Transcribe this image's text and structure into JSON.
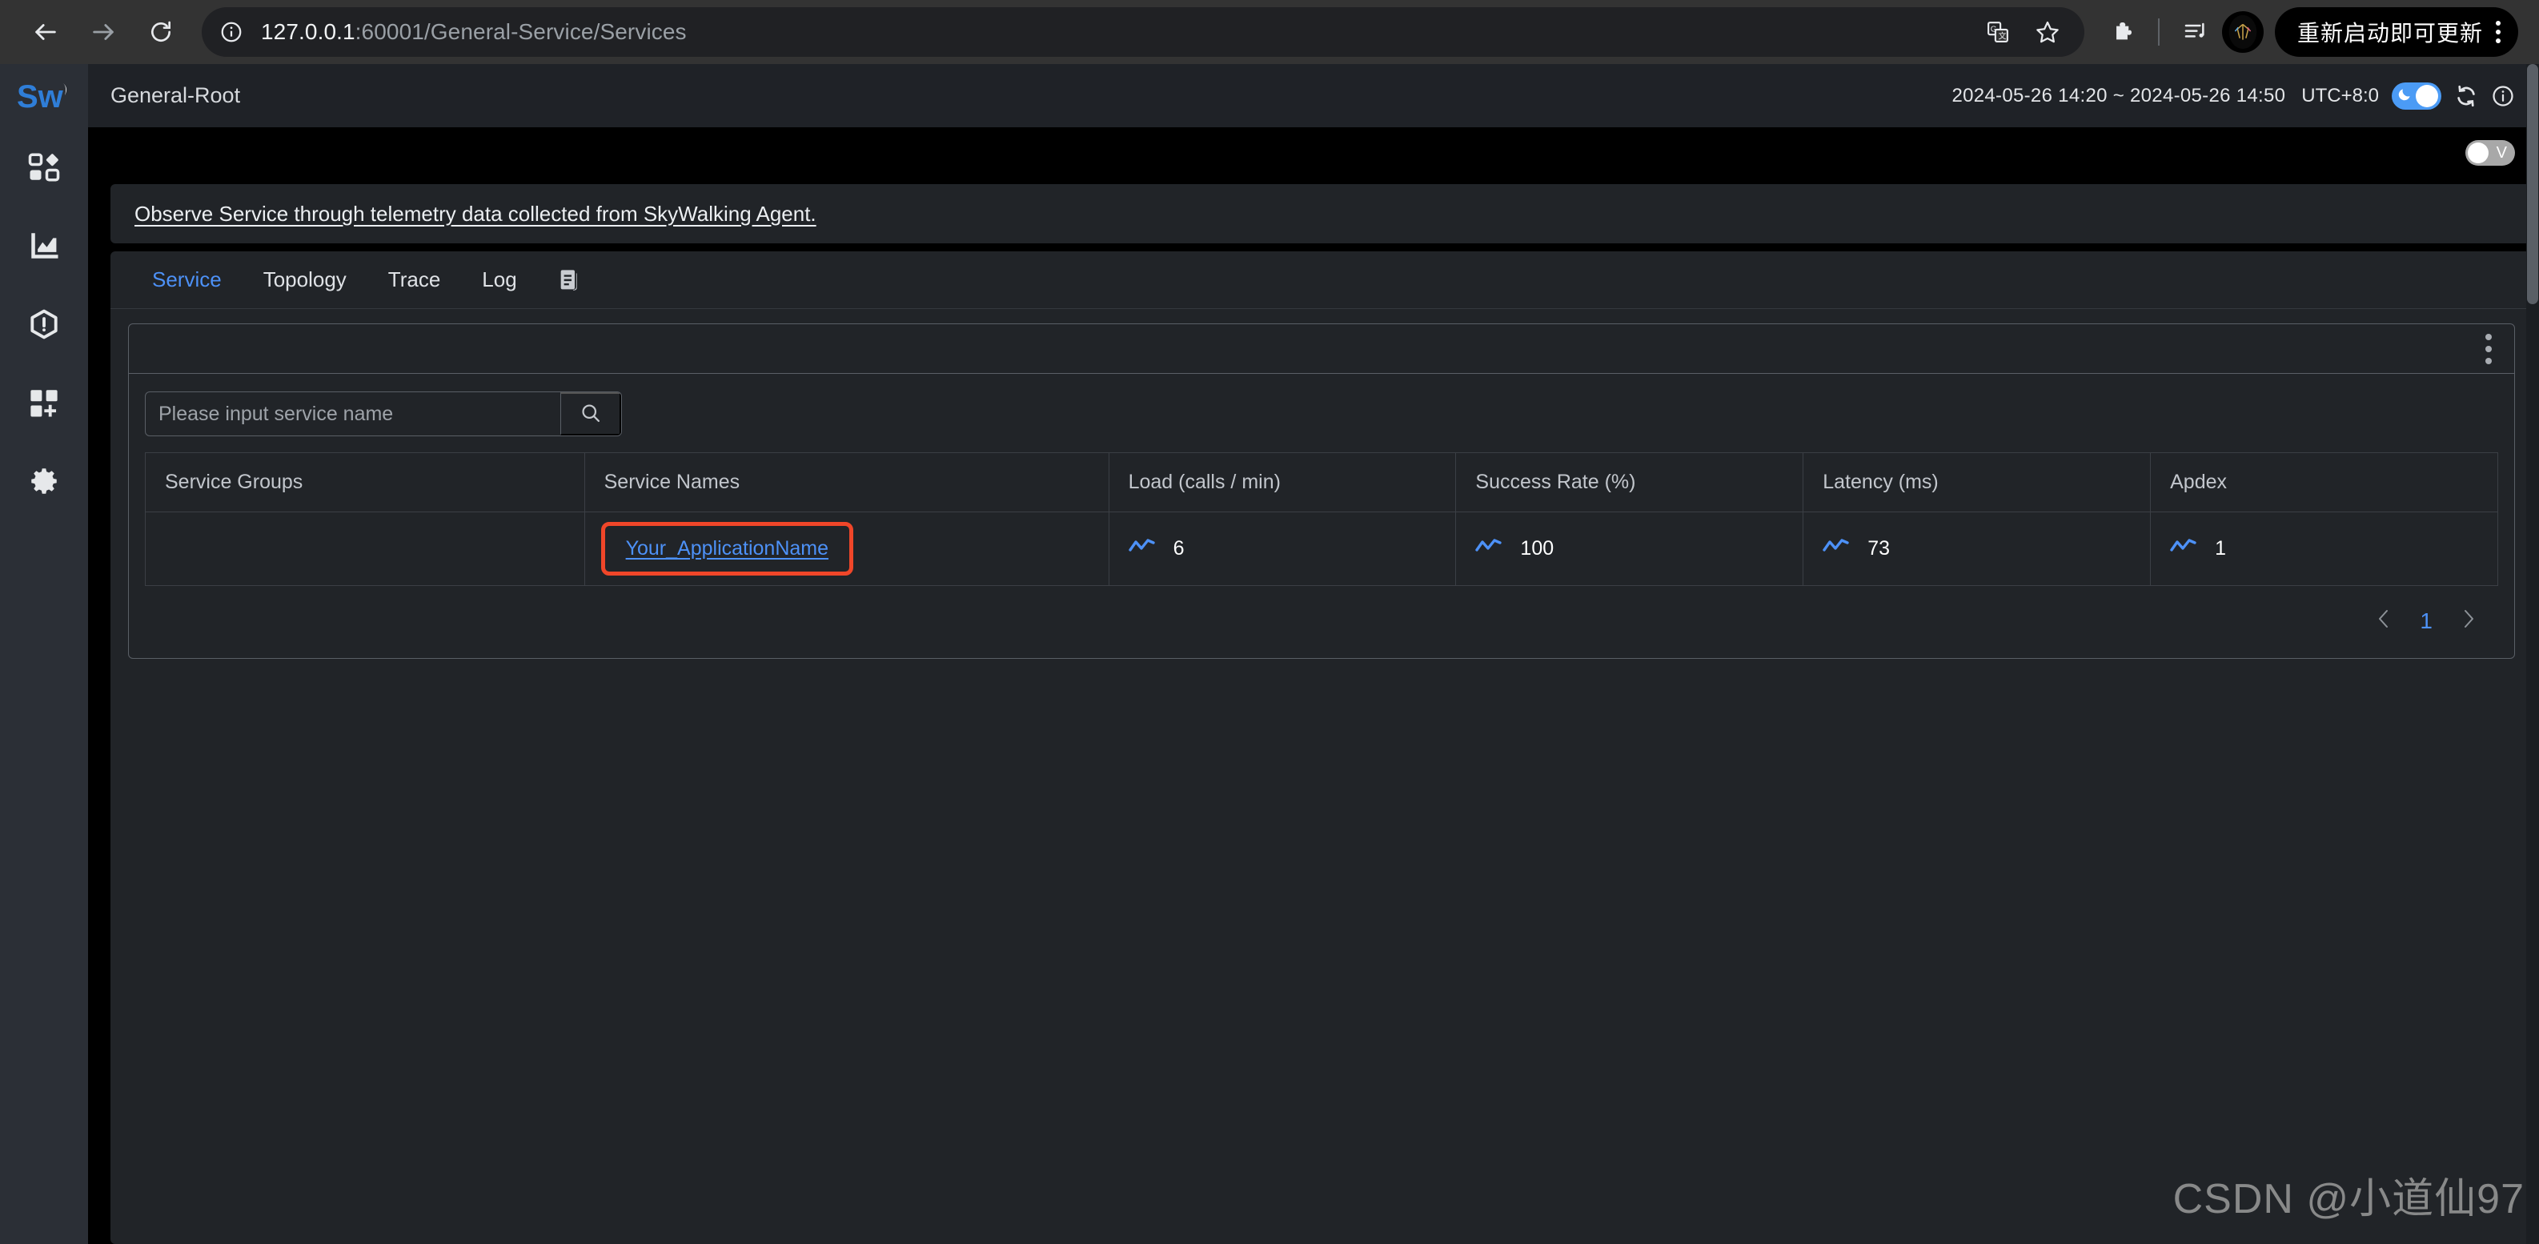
{
  "browser": {
    "back_icon": "arrow-left-icon",
    "forward_icon": "arrow-right-icon",
    "reload_icon": "reload-icon",
    "site_info_icon": "info-circle-icon",
    "url_host": "127.0.0.1",
    "url_rest": ":60001/General-Service/Services",
    "translate_icon": "translate-icon",
    "bookmark_icon": "star-icon",
    "extensions_icon": "puzzle-icon",
    "media_icon": "playlist-music-icon",
    "profile_icon": "avatar-icon",
    "update_label": "重新启动即可更新",
    "menu_icon": "kebab-menu-icon"
  },
  "sidebar": {
    "logo_text": "SW",
    "items": [
      {
        "name": "dashboard",
        "icon": "grid-diamond-icon"
      },
      {
        "name": "metrics",
        "icon": "chart-icon"
      },
      {
        "name": "alarm",
        "icon": "hexagon-alert-icon"
      },
      {
        "name": "dashboard-new",
        "icon": "grid-plus-icon"
      },
      {
        "name": "settings",
        "icon": "gear-icon"
      }
    ]
  },
  "header": {
    "title": "General-Root",
    "time_range": "2024-05-26 14:20 ~ 2024-05-26 14:50",
    "timezone": "UTC+8:0",
    "theme_toggle_icon": "moon-icon",
    "refresh_icon": "refresh-icon",
    "info_icon": "info-icon",
    "accent_color": "#4b9bf5"
  },
  "subbar": {
    "toggle_label": "V"
  },
  "description": {
    "text": "Observe Service through telemetry data collected from SkyWalking Agent."
  },
  "tabs": [
    {
      "label": "Service",
      "active": true
    },
    {
      "label": "Topology",
      "active": false
    },
    {
      "label": "Trace",
      "active": false
    },
    {
      "label": "Log",
      "active": false
    }
  ],
  "tabs_extra_icon": "copy-icon",
  "widget": {
    "menu_icon": "vertical-dots-icon"
  },
  "search": {
    "placeholder": "Please input service name",
    "value": "",
    "button_icon": "search-icon"
  },
  "table": {
    "columns": [
      "Service Groups",
      "Service Names",
      "Load (calls / min)",
      "Success Rate (%)",
      "Latency (ms)",
      "Apdex"
    ],
    "rows": [
      {
        "group": "",
        "name": "Your_ApplicationName",
        "name_highlighted": true,
        "load": "6",
        "success_rate": "100",
        "latency": "73",
        "apdex": "1",
        "trend_icon": "trend-line-icon"
      }
    ]
  },
  "pagination": {
    "prev_icon": "chevron-left-icon",
    "next_icon": "chevron-right-icon",
    "current_page": "1"
  },
  "watermark": {
    "text": "CSDN @小道仙97"
  },
  "colors": {
    "link_blue": "#4d91f7",
    "highlight_red": "#f04629",
    "panel_bg": "#212428",
    "sidebar_bg": "#2b2f36"
  }
}
